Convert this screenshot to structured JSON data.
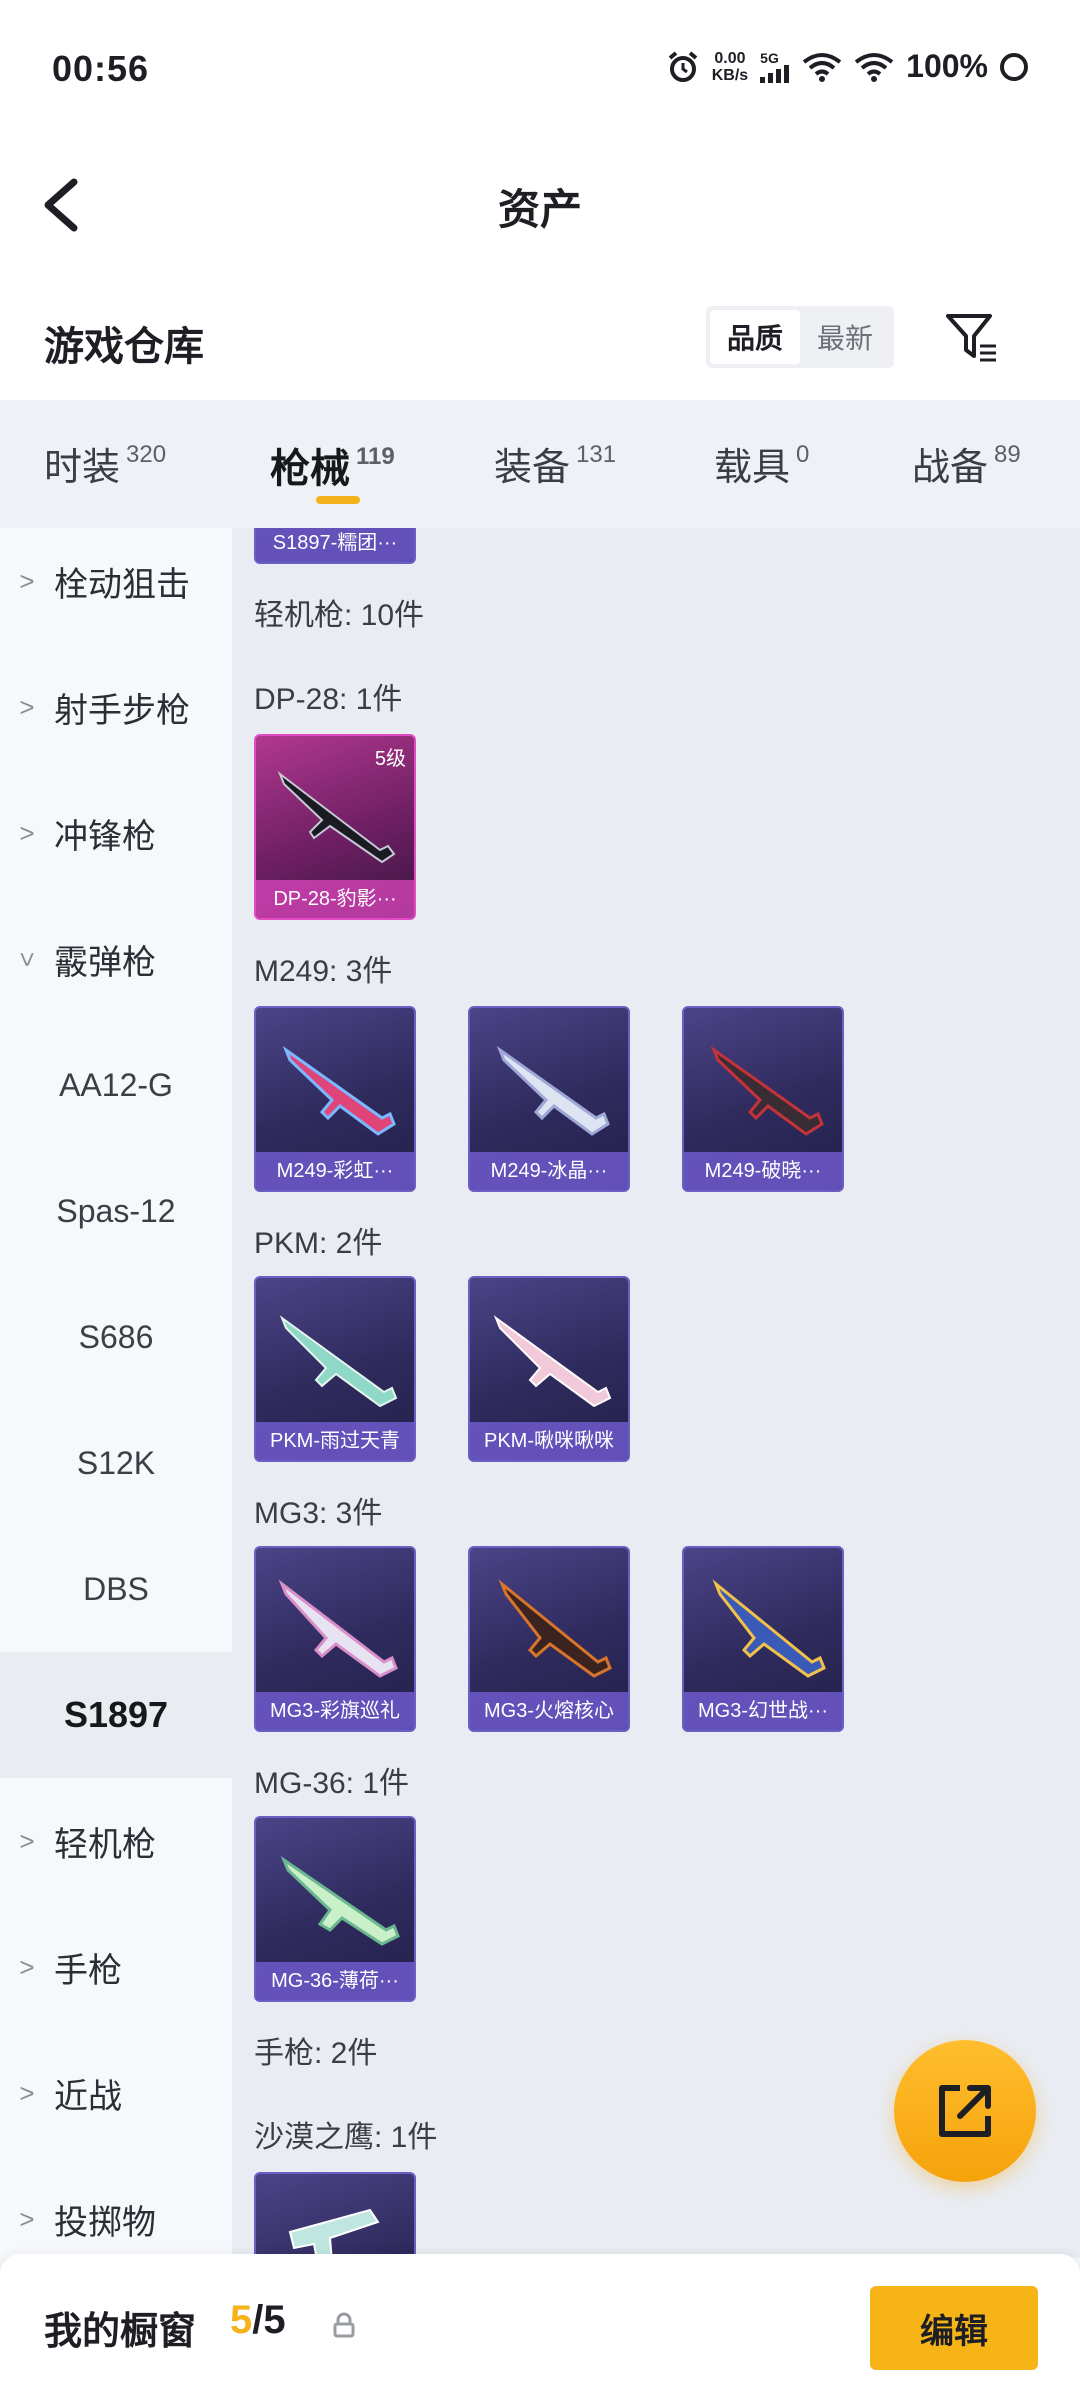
{
  "status": {
    "time": "00:56",
    "speed_top": "0.00",
    "speed_unit": "KB/s",
    "network": "5G",
    "battery": "100%"
  },
  "nav": {
    "title": "资产"
  },
  "header": {
    "title": "游戏仓库",
    "sort_quality": "品质",
    "sort_newest": "最新"
  },
  "tabs": [
    {
      "label": "时装",
      "count": "320"
    },
    {
      "label": "枪械",
      "count": "119"
    },
    {
      "label": "装备",
      "count": "131"
    },
    {
      "label": "载具",
      "count": "0"
    },
    {
      "label": "战备",
      "count": "89"
    }
  ],
  "sidebar": {
    "items": [
      {
        "label": "栓动狙击"
      },
      {
        "label": "射手步枪"
      },
      {
        "label": "冲锋枪"
      },
      {
        "label": "霰弹枪"
      },
      {
        "label": "AA12-G"
      },
      {
        "label": "Spas-12"
      },
      {
        "label": "S686"
      },
      {
        "label": "S12K"
      },
      {
        "label": "DBS"
      },
      {
        "label": "S1897"
      },
      {
        "label": "轻机枪"
      },
      {
        "label": "手枪"
      },
      {
        "label": "近战"
      },
      {
        "label": "投掷物"
      }
    ]
  },
  "content": {
    "top_card": "S1897-糯团···",
    "groups": [
      {
        "label": "轻机枪: 10件"
      },
      {
        "label": "DP-28: 1件",
        "cards": [
          {
            "name": "DP-28-豹影···",
            "level": "5级"
          }
        ]
      },
      {
        "label": "M249: 3件",
        "cards": [
          {
            "name": "M249-彩虹···"
          },
          {
            "name": "M249-冰晶···"
          },
          {
            "name": "M249-破晓···"
          }
        ]
      },
      {
        "label": "PKM: 2件",
        "cards": [
          {
            "name": "PKM-雨过天青"
          },
          {
            "name": "PKM-啾咪啾咪"
          }
        ]
      },
      {
        "label": "MG3: 3件",
        "cards": [
          {
            "name": "MG3-彩旗巡礼"
          },
          {
            "name": "MG3-火熔核心"
          },
          {
            "name": "MG3-幻世战···"
          }
        ]
      },
      {
        "label": "MG-36: 1件",
        "cards": [
          {
            "name": "MG-36-薄荷···"
          }
        ]
      },
      {
        "label": "手枪: 2件"
      },
      {
        "label": "沙漠之鹰: 1件"
      }
    ]
  },
  "bottom": {
    "title": "我的橱窗",
    "count_current": "5",
    "count_total": "/5",
    "edit_label": "编辑"
  },
  "icons": {
    "back": "chevron-left-icon",
    "filter": "filter-icon",
    "share": "external-link-icon",
    "lock": "lock-icon",
    "alarm": "alarm-icon",
    "wifi": "wifi-icon"
  },
  "colors": {
    "accent": "#f4b21b",
    "card_purple": "#2e2a5c",
    "card_pink": "#b1388f"
  }
}
